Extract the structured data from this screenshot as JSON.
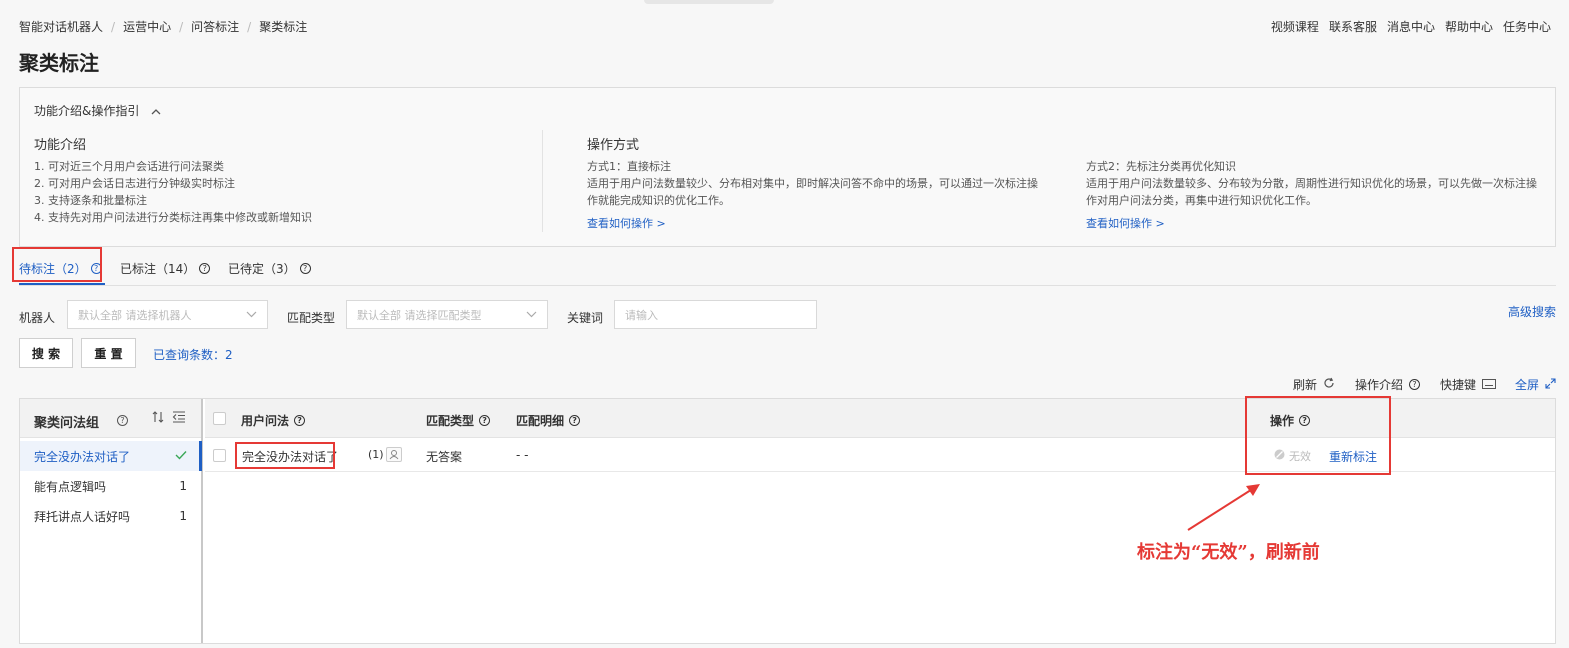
{
  "breadcrumb": [
    "智能对话机器人",
    "运营中心",
    "问答标注",
    "聚类标注"
  ],
  "top_links": [
    "视频课程",
    "联系客服",
    "消息中心",
    "帮助中心",
    "任务中心"
  ],
  "page_title": "聚类标注",
  "intro": {
    "toggle_label": "功能介绍&操作指引",
    "features_title": "功能介绍",
    "features": [
      "1. 可对近三个月用户会话进行问法聚类",
      "2. 可对用户会话日志进行分钟级实时标注",
      "3. 支持逐条和批量标注",
      "4. 支持先对用户问法进行分类标注再集中修改或新增知识"
    ],
    "methods_title": "操作方式",
    "method1": {
      "title": "方式1：直接标注",
      "desc_line1": "适用于用户问法数量较少、分布相对集中，即时解决问答不命中的场景，可以通过一次标注操",
      "desc_line2": "作就能完成知识的优化工作。",
      "link": "查看如何操作 >"
    },
    "method2": {
      "title": "方式2：先标注分类再优化知识",
      "desc_line1": "适用于用户问法数量较多、分布较为分散，周期性进行知识优化的场景，可以先做一次标注操",
      "desc_line2": "作对用户问法分类，再集中进行知识优化工作。",
      "link": "查看如何操作 >"
    }
  },
  "tabs": [
    {
      "label": "待标注（2）",
      "active": true
    },
    {
      "label": "已标注（14）",
      "active": false
    },
    {
      "label": "已待定（3）",
      "active": false
    }
  ],
  "filters": {
    "robot_label": "机器人",
    "robot_placeholder": "默认全部 请选择机器人",
    "match_label": "匹配类型",
    "match_placeholder": "默认全部 请选择匹配类型",
    "keyword_label": "关键词",
    "keyword_placeholder": "请输入",
    "advanced_search": "高级搜索",
    "search_button": "搜 索",
    "reset_button": "重 置",
    "result_count": "已查询条数：2"
  },
  "toolbar": {
    "refresh": "刷新",
    "guide": "操作介绍",
    "shortcut": "快捷键",
    "fullscreen": "全屏"
  },
  "groups": {
    "header": "聚类问法组",
    "items": [
      {
        "label": "完全没办法对话了",
        "count": "",
        "active": true
      },
      {
        "label": "能有点逻辑吗",
        "count": "1",
        "active": false
      },
      {
        "label": "拜托讲点人话好吗",
        "count": "1",
        "active": false
      }
    ]
  },
  "table": {
    "columns": [
      "用户问法",
      "匹配类型",
      "匹配明细",
      "操作"
    ],
    "rows": [
      {
        "question": "完全没办法对话了",
        "count": "(1)",
        "match_type": "无答案",
        "match_detail": "- -",
        "action_invalid": "无效",
        "action_relabel": "重新标注"
      }
    ]
  },
  "annotation": {
    "text": "标注为“无效”，刷新前",
    "color": "#e53935"
  },
  "colors": {
    "accent": "#1f5fc4",
    "highlight": "#e53935"
  }
}
